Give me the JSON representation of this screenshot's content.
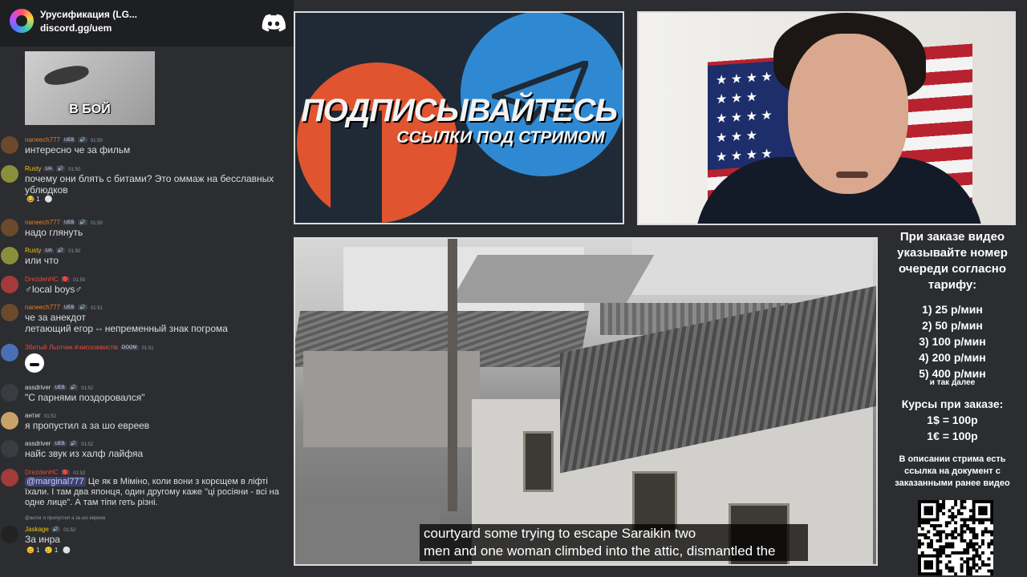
{
  "discord": {
    "server_name": "Урусификация (LG...",
    "invite": "discord.gg/uem",
    "gif_caption": "В БОЙ",
    "messages": [
      {
        "user": "naneech777",
        "badges": [
          "UEB",
          "🔊"
        ],
        "time": "01:50",
        "text": "интересно че за фильм",
        "user_color": "#e67e22",
        "avatar_color": "#6b4a2b"
      },
      {
        "user": "Rusty",
        "badges": [
          "UA",
          "🔊"
        ],
        "time": "01:50",
        "text": "почему они блять с битами? Это оммаж на бесславных ублюдков",
        "user_color": "#f1c40f",
        "avatar_color": "#8c8f3a",
        "reactions": [
          "😂 1",
          "⚪"
        ]
      },
      {
        "user": "naneech777",
        "badges": [
          "UEB",
          "🔊"
        ],
        "time": "01:50",
        "text": "надо глянуть",
        "user_color": "#e67e22",
        "avatar_color": "#6b4a2b"
      },
      {
        "user": "Rusty",
        "badges": [
          "UA",
          "🔊"
        ],
        "time": "01:50",
        "text": "или что",
        "user_color": "#f1c40f",
        "avatar_color": "#8c8f3a"
      },
      {
        "user": "DrezdenHC",
        "badges": [
          "🔴"
        ],
        "time": "01:50",
        "text": "♂local boys♂",
        "user_color": "#e74c3c",
        "avatar_color": "#a33b3b"
      },
      {
        "user": "naneech777",
        "badges": [
          "UEB",
          "🔊"
        ],
        "time": "01:51",
        "text": "че за анекдот\nлетающий егор -- непременный знак погрома",
        "user_color": "#e67e22",
        "avatar_color": "#6b4a2b"
      },
      {
        "user": "Збитый Льотчик #чмозожвистів",
        "badges": [
          "DOOM"
        ],
        "time": "01:51",
        "text": "",
        "user_color": "#e74c3c",
        "avatar_color": "#4a6fb5"
      },
      {
        "user": "assdriver",
        "badges": [
          "UEB",
          "🔊"
        ],
        "time": "01:52",
        "text": "\"С парнями поздоровался\"",
        "user_color": "#dbdee1",
        "avatar_color": "#3a3c42"
      },
      {
        "user": "антиг",
        "badges": [],
        "time": "01:52",
        "text": "я пропустил а за шо евреев",
        "user_color": "#dbdee1",
        "avatar_color": "#c9a26a"
      },
      {
        "user": "assdriver",
        "badges": [
          "UEB",
          "🔊"
        ],
        "time": "01:52",
        "text": "найс звук из халф лайфяа",
        "user_color": "#dbdee1",
        "avatar_color": "#3a3c42"
      },
      {
        "user": "DrezdenHC",
        "badges": [
          "🔴"
        ],
        "time": "01:52",
        "mention": "@marginal777",
        "text": " Це як в Міміно, коли вони з корєщем в лiфтi їхали. І там два японця, один другому каже \"цi росiяни - всi на одне лице\". А там тiпи геть рiзнi.",
        "user_color": "#e74c3c",
        "avatar_color": "#a33b3b"
      },
      {
        "reply": "@антиг я пропустил а за шо евреев",
        "user": "Jaskage",
        "badges": [
          "🔊"
        ],
        "time": "01:52",
        "text": "За инра",
        "user_color": "#f1c40f",
        "avatar_color": "#222222",
        "reactions": [
          "😊 1",
          "🥲 1",
          "⚪"
        ]
      }
    ]
  },
  "promo": {
    "title": "ПОДПИСЫВАЙТЕСЬ",
    "subtitle": "ССЫЛКИ ПОД СТРИМОМ"
  },
  "video": {
    "subtitle_line1": "courtyard some trying to escape Saraikin two",
    "subtitle_line2": "men and one woman climbed into the attic, dismantled the"
  },
  "info": {
    "order_text": "При заказе видео указывайте номер очереди согласно тарифу:",
    "prices": [
      "1) 25 р/мин",
      "2) 50 р/мин",
      "3) 100 р/мин",
      "4) 200 р/мин",
      "5) 400 р/мин"
    ],
    "etc": "и так далее",
    "rates_title": "Курсы при заказе:",
    "rates": [
      "1$ = 100р",
      "1€ = 100р"
    ],
    "description": "В описании стрима есть ссылка на документ с заказанными ранее видео"
  }
}
